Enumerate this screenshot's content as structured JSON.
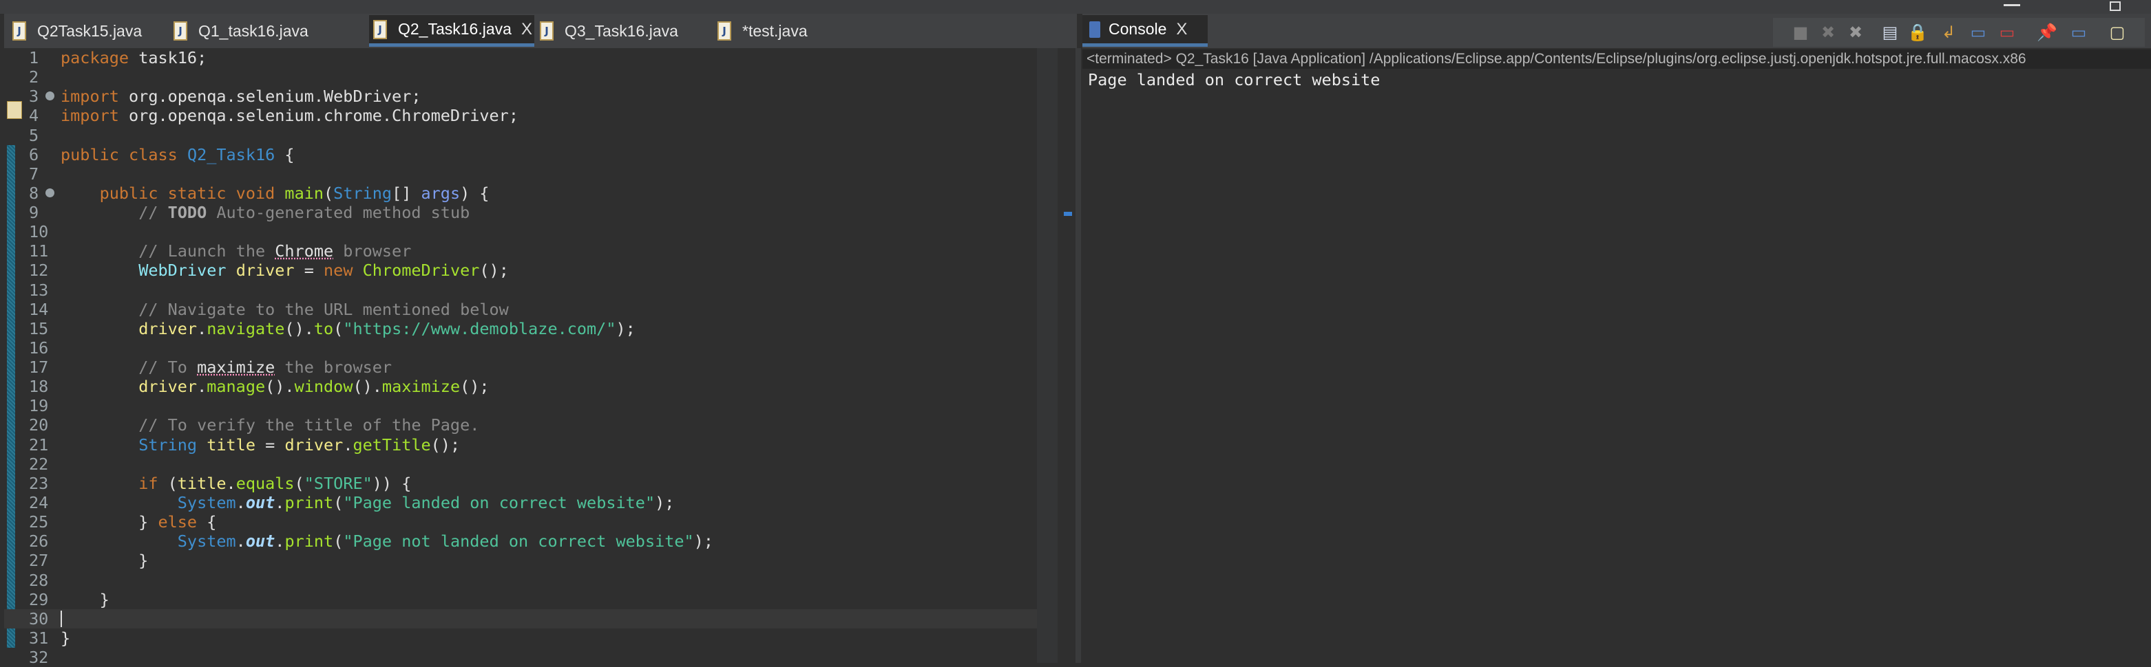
{
  "editor": {
    "tabs": [
      {
        "label": "Q2Task15.java",
        "active": false
      },
      {
        "label": "Q1_task16.java",
        "active": false
      },
      {
        "label": "Q2_Task16.java",
        "active": true
      },
      {
        "label": "Q3_Task16.java",
        "active": false
      },
      {
        "label": "*test.java",
        "active": false
      }
    ],
    "close_glyph": "X",
    "current_line": 30,
    "lines": [
      [
        [
          "kw",
          "package"
        ],
        [
          "d",
          " task16;"
        ]
      ],
      [],
      [
        [
          "kw",
          "import"
        ],
        [
          "d",
          " org.openqa.selenium.WebDriver;"
        ]
      ],
      [
        [
          "kw",
          "import"
        ],
        [
          "d",
          " org.openqa.selenium.chrome.ChromeDriver;"
        ]
      ],
      [],
      [
        [
          "kw",
          "public class "
        ],
        [
          "cls",
          "Q2_Task16"
        ],
        [
          "d",
          " {"
        ]
      ],
      [],
      [
        [
          "d",
          "    "
        ],
        [
          "kw",
          "public static void "
        ],
        [
          "mth",
          "main"
        ],
        [
          "d",
          "("
        ],
        [
          "cls",
          "String"
        ],
        [
          "d",
          "[] "
        ],
        [
          "par",
          "args"
        ],
        [
          "d",
          ") {"
        ]
      ],
      [
        [
          "d",
          "        "
        ],
        [
          "cm",
          "// "
        ],
        [
          "todo",
          "TODO"
        ],
        [
          "cm",
          " Auto-generated method stub"
        ]
      ],
      [],
      [
        [
          "d",
          "        "
        ],
        [
          "cm",
          "// Launch the "
        ],
        [
          "sp",
          "Chrome"
        ],
        [
          "cm",
          " browser"
        ]
      ],
      [
        [
          "d",
          "        "
        ],
        [
          "type",
          "WebDriver"
        ],
        [
          "d",
          " "
        ],
        [
          "var",
          "driver"
        ],
        [
          "d",
          " = "
        ],
        [
          "kw",
          "new "
        ],
        [
          "mth",
          "ChromeDriver"
        ],
        [
          "d",
          "();"
        ]
      ],
      [],
      [
        [
          "d",
          "        "
        ],
        [
          "cm",
          "// Navigate to the URL mentioned below"
        ]
      ],
      [
        [
          "d",
          "        "
        ],
        [
          "var",
          "driver"
        ],
        [
          "d",
          "."
        ],
        [
          "mth",
          "navigate"
        ],
        [
          "d",
          "()."
        ],
        [
          "mth",
          "to"
        ],
        [
          "d",
          "("
        ],
        [
          "str",
          "\"https://www.demoblaze.com/\""
        ],
        [
          "d",
          ");"
        ]
      ],
      [],
      [
        [
          "d",
          "        "
        ],
        [
          "cm",
          "// To "
        ],
        [
          "sp",
          "maximize"
        ],
        [
          "cm",
          " the browser"
        ]
      ],
      [
        [
          "d",
          "        "
        ],
        [
          "var",
          "driver"
        ],
        [
          "d",
          "."
        ],
        [
          "mth",
          "manage"
        ],
        [
          "d",
          "()."
        ],
        [
          "mth",
          "window"
        ],
        [
          "d",
          "()."
        ],
        [
          "mth",
          "maximize"
        ],
        [
          "d",
          "();"
        ]
      ],
      [],
      [
        [
          "d",
          "        "
        ],
        [
          "cm",
          "// To verify the title of the Page."
        ]
      ],
      [
        [
          "d",
          "        "
        ],
        [
          "cls",
          "String"
        ],
        [
          "d",
          " "
        ],
        [
          "var",
          "title"
        ],
        [
          "d",
          " = "
        ],
        [
          "var",
          "driver"
        ],
        [
          "d",
          "."
        ],
        [
          "mth",
          "getTitle"
        ],
        [
          "d",
          "();"
        ]
      ],
      [],
      [
        [
          "d",
          "        "
        ],
        [
          "kw",
          "if"
        ],
        [
          "d",
          " ("
        ],
        [
          "var",
          "title"
        ],
        [
          "d",
          "."
        ],
        [
          "mth",
          "equals"
        ],
        [
          "d",
          "("
        ],
        [
          "str",
          "\"STORE\""
        ],
        [
          "d",
          ")) {"
        ]
      ],
      [
        [
          "d",
          "            "
        ],
        [
          "cls",
          "System"
        ],
        [
          "d",
          "."
        ],
        [
          "fld",
          "out"
        ],
        [
          "d",
          "."
        ],
        [
          "mth",
          "print"
        ],
        [
          "d",
          "("
        ],
        [
          "str",
          "\"Page landed on correct website\""
        ],
        [
          "d",
          ");"
        ]
      ],
      [
        [
          "d",
          "        } "
        ],
        [
          "kw",
          "else"
        ],
        [
          "d",
          " {"
        ]
      ],
      [
        [
          "d",
          "            "
        ],
        [
          "cls",
          "System"
        ],
        [
          "d",
          "."
        ],
        [
          "fld",
          "out"
        ],
        [
          "d",
          "."
        ],
        [
          "mth",
          "print"
        ],
        [
          "d",
          "("
        ],
        [
          "str",
          "\"Page not landed on correct website\""
        ],
        [
          "d",
          ");"
        ]
      ],
      [
        [
          "d",
          "        }"
        ]
      ],
      [],
      [
        [
          "d",
          "    }"
        ]
      ],
      [],
      [
        [
          "d",
          "}"
        ]
      ],
      []
    ]
  },
  "console": {
    "tab_label": "Console",
    "status_line": "<terminated> Q2_Task16 [Java Application] /Applications/Eclipse.app/Contents/Eclipse/plugins/org.eclipse.justj.openjdk.hotspot.jre.full.macosx.x86",
    "output": "Page landed on correct website",
    "toolbar_icons": [
      "terminate-icon",
      "remove-launch-icon",
      "remove-all-terminated-icon",
      "clear-console-icon",
      "scroll-lock-icon",
      "word-wrap-icon",
      "show-on-stdout-icon",
      "show-on-stderr-icon",
      "pin-console-icon",
      "display-selected-console-icon",
      "open-console-icon"
    ]
  }
}
